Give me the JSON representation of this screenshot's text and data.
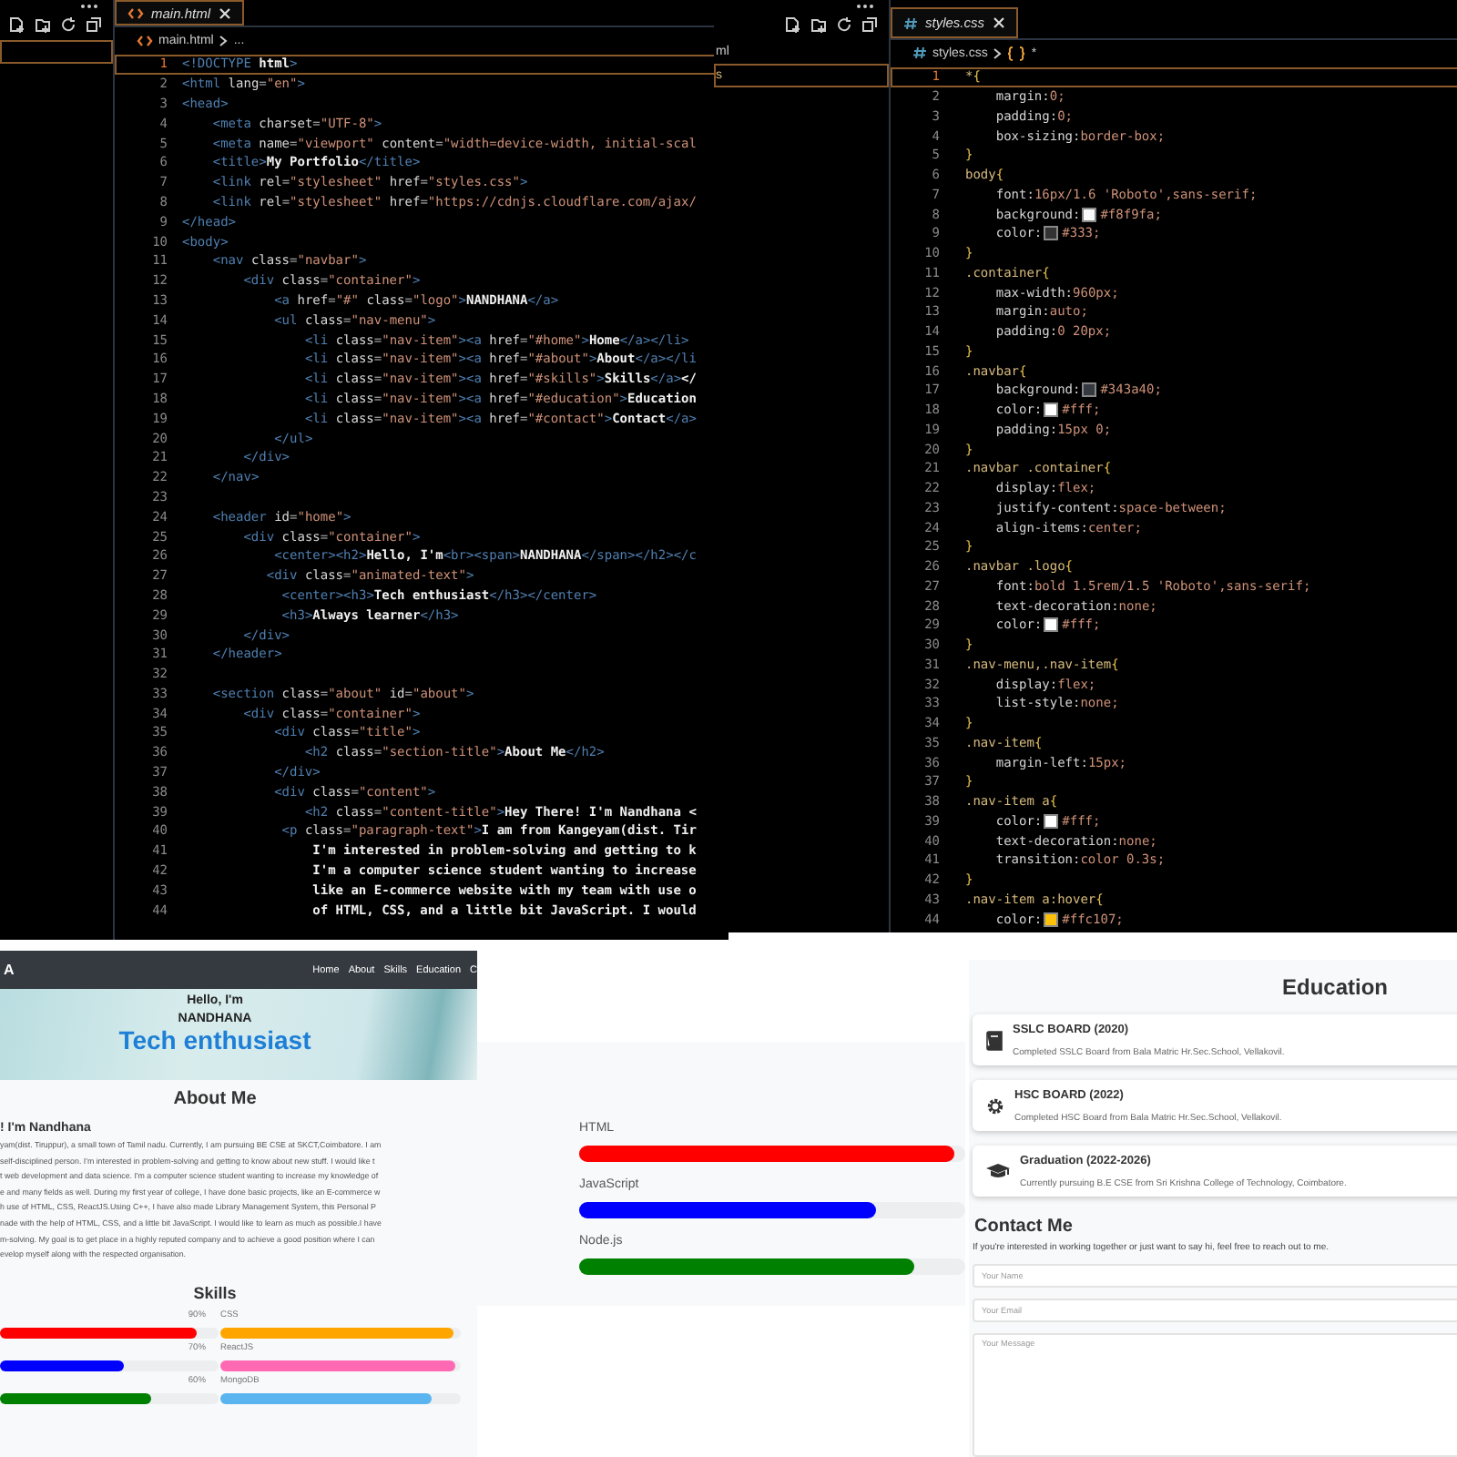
{
  "html_editor": {
    "sidebar": {
      "rows": [
        {
          "selected": true
        }
      ]
    },
    "tab": {
      "label": "main.html"
    },
    "breadcrumb": [
      {
        "text": "main.html"
      },
      {
        "text": "..."
      }
    ],
    "lines": [
      {
        "n": "1",
        "text": "<!DOCTYPE html>",
        "active": true
      },
      {
        "n": "2",
        "text": "<html lang=\"en\">",
        "active": false
      },
      {
        "n": "3",
        "text": "<head>",
        "active": false
      },
      {
        "n": "4",
        "text": "    <meta charset=\"UTF-8\">",
        "active": false
      },
      {
        "n": "5",
        "text": "    <meta name=\"viewport\" content=\"width=device-width, initial-scal",
        "active": false
      },
      {
        "n": "6",
        "text": "    <title>My Portfolio</title>",
        "active": false
      },
      {
        "n": "7",
        "text": "    <link rel=\"stylesheet\" href=\"styles.css\">",
        "active": false
      },
      {
        "n": "8",
        "text": "    <link rel=\"stylesheet\" href=\"https://cdnjs.cloudflare.com/ajax/",
        "active": false
      },
      {
        "n": "9",
        "text": "</head>",
        "active": false
      },
      {
        "n": "10",
        "text": "<body>",
        "active": false
      },
      {
        "n": "11",
        "text": "    <nav class=\"navbar\">",
        "active": false
      },
      {
        "n": "12",
        "text": "        <div class=\"container\">",
        "active": false
      },
      {
        "n": "13",
        "text": "            <a href=\"#\" class=\"logo\">NANDHANA</a>",
        "active": false
      },
      {
        "n": "14",
        "text": "            <ul class=\"nav-menu\">",
        "active": false
      },
      {
        "n": "15",
        "text": "                <li class=\"nav-item\"><a href=\"#home\">Home</a></li>",
        "active": false
      },
      {
        "n": "16",
        "text": "                <li class=\"nav-item\"><a href=\"#about\">About</a></li",
        "active": false
      },
      {
        "n": "17",
        "text": "                <li class=\"nav-item\"><a href=\"#skills\">Skills</a></",
        "active": false
      },
      {
        "n": "18",
        "text": "                <li class=\"nav-item\"><a href=\"#education\">Education",
        "active": false
      },
      {
        "n": "19",
        "text": "                <li class=\"nav-item\"><a href=\"#contact\">Contact</a>",
        "active": false
      },
      {
        "n": "20",
        "text": "            </ul>",
        "active": false
      },
      {
        "n": "21",
        "text": "        </div>",
        "active": false
      },
      {
        "n": "22",
        "text": "    </nav>",
        "active": false
      },
      {
        "n": "23",
        "active": false
      },
      {
        "n": "24",
        "text": "    <header id=\"home\">",
        "active": false
      },
      {
        "n": "25",
        "text": "        <div class=\"container\">",
        "active": false
      },
      {
        "n": "26",
        "text": "            <center><h2>Hello, I'm<br><span>NANDHANA</span></h2></c",
        "active": false
      },
      {
        "n": "27",
        "text": "           <div class=\"animated-text\">",
        "active": false
      },
      {
        "n": "28",
        "text": "             <center><h3>Tech enthusiast</h3></center>",
        "active": false
      },
      {
        "n": "29",
        "text": "             <h3>Always learner</h3>",
        "active": false
      },
      {
        "n": "30",
        "text": "        </div>",
        "active": false
      },
      {
        "n": "31",
        "text": "    </header>",
        "active": false
      },
      {
        "n": "32",
        "active": false
      },
      {
        "n": "33",
        "text": "    <section class=\"about\" id=\"about\">",
        "active": false
      },
      {
        "n": "34",
        "text": "        <div class=\"container\">",
        "active": false
      },
      {
        "n": "35",
        "text": "            <div class=\"title\">",
        "active": false
      },
      {
        "n": "36",
        "text": "                <h2 class=\"section-title\">About Me</h2>",
        "active": false
      },
      {
        "n": "37",
        "text": "            </div>",
        "active": false
      },
      {
        "n": "38",
        "text": "            <div class=\"content\">",
        "active": false
      },
      {
        "n": "39",
        "text": "                <h2 class=\"content-title\">Hey There! I'm Nandhana <",
        "active": false
      },
      {
        "n": "40",
        "text": "             <p class=\"paragraph-text\">I am from Kangeyam(dist. Tir",
        "active": false
      },
      {
        "n": "41",
        "text": "                 I'm interested in problem-solving and getting to k",
        "active": false
      },
      {
        "n": "42",
        "text": "                 I'm a computer science student wanting to increase",
        "active": false
      },
      {
        "n": "43",
        "text": "                 like an E-commerce website with my team with use o",
        "active": false
      },
      {
        "n": "44",
        "text": "                 of HTML, CSS, and a little bit JavaScript. I would",
        "active": false
      }
    ]
  },
  "css_editor": {
    "sidebar": {
      "rows": [
        {
          "text": "ml",
          "selected": false
        },
        {
          "text": "s",
          "selected": true
        }
      ]
    },
    "tab": {
      "label": "styles.css"
    },
    "breadcrumb": [
      {
        "text": "styles.css"
      },
      {
        "text": "*"
      }
    ],
    "lines": [
      {
        "n": "1",
        "text": "*{",
        "active": true
      },
      {
        "n": "2",
        "text": "    margin:0;",
        "active": false
      },
      {
        "n": "3",
        "text": "    padding:0;",
        "active": false
      },
      {
        "n": "4",
        "text": "    box-sizing:border-box;",
        "active": false
      },
      {
        "n": "5",
        "text": "}",
        "active": false
      },
      {
        "n": "6",
        "text": "body{",
        "active": false
      },
      {
        "n": "7",
        "text": "    font:16px/1.6 'Roboto',sans-serif;",
        "active": false
      },
      {
        "n": "8",
        "text": "    background:",
        "color": "#f8f9fa",
        "after": "#f8f9fa;",
        "active": false
      },
      {
        "n": "9",
        "text": "    color:",
        "color": "#333333",
        "after": "#333;",
        "active": false
      },
      {
        "n": "10",
        "text": "}",
        "active": false
      },
      {
        "n": "11",
        "text": ".container{",
        "active": false
      },
      {
        "n": "12",
        "text": "    max-width:960px;",
        "active": false
      },
      {
        "n": "13",
        "text": "    margin:auto;",
        "active": false
      },
      {
        "n": "14",
        "text": "    padding:0 20px;",
        "active": false
      },
      {
        "n": "15",
        "text": "}",
        "active": false
      },
      {
        "n": "16",
        "text": ".navbar{",
        "active": false
      },
      {
        "n": "17",
        "text": "    background:",
        "color": "#343a40",
        "after": "#343a40;",
        "active": false
      },
      {
        "n": "18",
        "text": "    color:",
        "color": "#ffffff",
        "after": "#fff;",
        "active": false
      },
      {
        "n": "19",
        "text": "    padding:15px 0;",
        "active": false
      },
      {
        "n": "20",
        "text": "}",
        "active": false
      },
      {
        "n": "21",
        "text": ".navbar .container{",
        "active": false
      },
      {
        "n": "22",
        "text": "    display:flex;",
        "active": false
      },
      {
        "n": "23",
        "text": "    justify-content:space-between;",
        "active": false
      },
      {
        "n": "24",
        "text": "    align-items:center;",
        "active": false
      },
      {
        "n": "25",
        "text": "}",
        "active": false
      },
      {
        "n": "26",
        "text": ".navbar .logo{",
        "active": false
      },
      {
        "n": "27",
        "text": "    font:bold 1.5rem/1.5 'Roboto',sans-serif;",
        "active": false
      },
      {
        "n": "28",
        "text": "    text-decoration:none;",
        "active": false
      },
      {
        "n": "29",
        "text": "    color:",
        "color": "#ffffff",
        "after": "#fff;",
        "active": false
      },
      {
        "n": "30",
        "text": "}",
        "active": false
      },
      {
        "n": "31",
        "text": ".nav-menu,.nav-item{",
        "active": false
      },
      {
        "n": "32",
        "text": "    display:flex;",
        "active": false
      },
      {
        "n": "33",
        "text": "    list-style:none;",
        "active": false
      },
      {
        "n": "34",
        "text": "}",
        "active": false
      },
      {
        "n": "35",
        "text": ".nav-item{",
        "active": false
      },
      {
        "n": "36",
        "text": "    margin-left:15px;",
        "active": false
      },
      {
        "n": "37",
        "text": "}",
        "active": false
      },
      {
        "n": "38",
        "text": ".nav-item a{",
        "active": false
      },
      {
        "n": "39",
        "text": "    color:",
        "color": "#ffffff",
        "after": "#fff;",
        "active": false
      },
      {
        "n": "40",
        "text": "    text-decoration:none;",
        "active": false
      },
      {
        "n": "41",
        "text": "    transition:color 0.3s;",
        "active": false
      },
      {
        "n": "42",
        "text": "}",
        "active": false
      },
      {
        "n": "43",
        "text": ".nav-item a:hover{",
        "active": false
      },
      {
        "n": "44",
        "text": "    color:",
        "color": "#ffc107",
        "after": "#ffc107;",
        "active": false
      }
    ]
  },
  "portfolio": {
    "navbar": {
      "logo": "A",
      "links": [
        "Home",
        "About",
        "Skills",
        "Education",
        "C"
      ]
    },
    "hero": {
      "greeting": "Hello, I'm",
      "name": "NANDHANA",
      "tagline": "Tech enthusiast"
    },
    "about": {
      "title": "About Me",
      "subtitle": "! I'm Nandhana",
      "paragraph": [
        "yam(dist. Tiruppur), a small town of Tamil nadu. Currently, I am pursuing BE CSE at SKCT,Coimbatore. I am",
        "self-disciplined person. I'm interested in problem-solving and getting to know about new stuff. I would like t",
        "t web development and data science. I'm a computer science student wanting to increase my knowledge of",
        "e and many fields as well. During my first year of college, I have done basic projects, like an E-commerce w",
        "h use of HTML, CSS, ReactJS.Using C++, I have also made Library Management System, this Personal P",
        "nade with the help of HTML, CSS, and a little bit JavaScript. I would like to learn as much as possible.I have",
        "m-solving. My goal is to get place in a highly reputed company and to achieve a good position where I can",
        "evelop myself along with the respected organisation."
      ]
    },
    "skills": {
      "title": "Skills",
      "left": [
        {
          "percent": "90%",
          "level": 0.9,
          "color": "#ff0000"
        },
        {
          "percent": "70%",
          "level": 0.57,
          "color": "#0000ff"
        },
        {
          "percent": "60%",
          "level": 0.69,
          "color": "#008000"
        }
      ],
      "right": [
        {
          "name": "CSS",
          "level": 0.97,
          "color": "#ffa500"
        },
        {
          "name": "ReactJS",
          "level": 0.98,
          "color": "#ff69b4"
        },
        {
          "name": "MongoDB",
          "level": 0.88,
          "color": "#5ab4f0"
        }
      ]
    }
  },
  "skills_detail": {
    "items": [
      {
        "name": "HTML",
        "level": 0.97,
        "color": "#ff0000"
      },
      {
        "name": "JavaScript",
        "level": 0.77,
        "color": "#0000ff"
      },
      {
        "name": "Node.js",
        "level": 0.87,
        "color": "#008000"
      }
    ]
  },
  "education": {
    "title": "Education",
    "items": [
      {
        "title": "SSLC BOARD (2020)",
        "text": "Completed SSLC Board from Bala Matric Hr.Sec.School, Vellakovil."
      },
      {
        "title": "HSC BOARD (2022)",
        "text": "Completed HSC Board from Bala Matric Hr.Sec.School, Vellakovil."
      },
      {
        "title": "Graduation (2022-2026)",
        "text": "Currently pursuing B.E CSE from Sri Krishna College of Technology, Coimbatore."
      }
    ],
    "contact": {
      "title": "Contact Me",
      "text": "If you're interested in working together or just want to say hi, feel free to reach out to me.",
      "name_field": {
        "placeholder": "Your Name"
      },
      "email_field": {
        "placeholder": "Your Email"
      },
      "message_field": {
        "placeholder": "Your Message"
      }
    }
  }
}
